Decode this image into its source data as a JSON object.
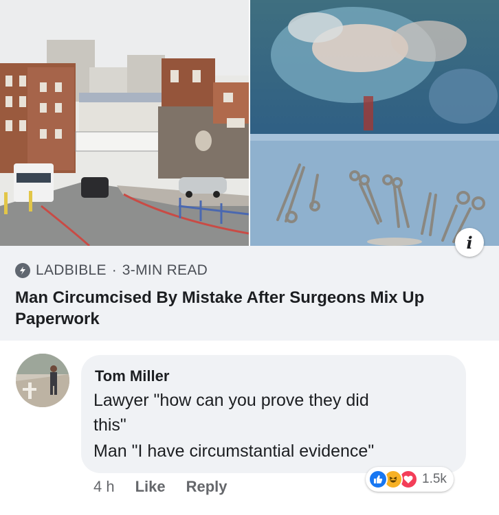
{
  "link_preview": {
    "source": "LADBIBLE",
    "separator": "·",
    "read_time": "3-MIN READ",
    "headline": "Man Circumcised By Mistake After Surgeons Mix Up Paperwork",
    "image_left": "hospital-building-photo",
    "image_right": "surgical-instruments-photo",
    "info_icon": "i"
  },
  "comment": {
    "author": "Tom Miller",
    "lines": [
      "Lawyer \"how can you prove they did",
      "this\"",
      "Man \"I have circumstantial evidence\""
    ]
  },
  "actions": {
    "time": "4 h",
    "like_label": "Like",
    "reply_label": "Reply"
  },
  "reactions": {
    "icons": [
      "like-icon",
      "haha-icon",
      "love-icon"
    ],
    "count": "1.5k"
  },
  "colors": {
    "card_background": "#f0f2f5",
    "like_blue": "#1877f2",
    "haha_yellow": "#f7b125",
    "love_red": "#f33e58"
  }
}
